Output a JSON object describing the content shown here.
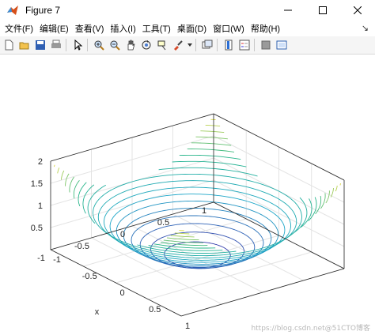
{
  "window": {
    "title": "Figure 7"
  },
  "menu": {
    "items": [
      {
        "id": "file",
        "label": "文件(F)"
      },
      {
        "id": "edit",
        "label": "编辑(E)"
      },
      {
        "id": "view",
        "label": "查看(V)"
      },
      {
        "id": "insert",
        "label": "插入(I)"
      },
      {
        "id": "tools",
        "label": "工具(T)"
      },
      {
        "id": "desktop",
        "label": "桌面(D)"
      },
      {
        "id": "window",
        "label": "窗口(W)"
      },
      {
        "id": "help",
        "label": "帮助(H)"
      }
    ],
    "dock_glyph": "↘"
  },
  "toolbar": {
    "icons": [
      "new-icon",
      "open-icon",
      "save-icon",
      "print-icon",
      "pointer-icon",
      "zoom-in-icon",
      "zoom-out-icon",
      "pan-icon",
      "rotate-icon",
      "data-cursor-icon",
      "brush-icon",
      "link-icon",
      "colorbar-icon",
      "legend-icon",
      "hide-tools-icon",
      "dock-figure-icon"
    ]
  },
  "colors": {
    "ring_low": "#3a2fa8",
    "ring_mid": "#1ea6c8",
    "ring_high": "#27b58a",
    "ring_top": "#f5dc3a",
    "grid": "#e3e3e3",
    "axis": "#262626"
  },
  "chart_data": {
    "type": "contour3",
    "zlim": [
      0,
      2
    ],
    "xlim": [
      -1,
      1
    ],
    "ylim": [
      -1,
      1
    ],
    "z_ticks": [
      "2",
      "1.5",
      "1",
      "0.5"
    ],
    "x_ticks": [
      "-1",
      "-0.5",
      "0",
      "0.5",
      "1"
    ],
    "y_ticks": [
      "1",
      "0.5",
      "0",
      "-0.5",
      "-1"
    ],
    "xlabel": "x",
    "ylabel": "",
    "levels": [
      0.1,
      0.2,
      0.3,
      0.4,
      0.5,
      0.6,
      0.7,
      0.8,
      0.9,
      1.0,
      1.1,
      1.2,
      1.3,
      1.4,
      1.5,
      1.6,
      1.7,
      1.8,
      1.9,
      2.0
    ],
    "grid": true,
    "box": true
  },
  "watermark": "https://blog.csdn.net@51CTO博客"
}
